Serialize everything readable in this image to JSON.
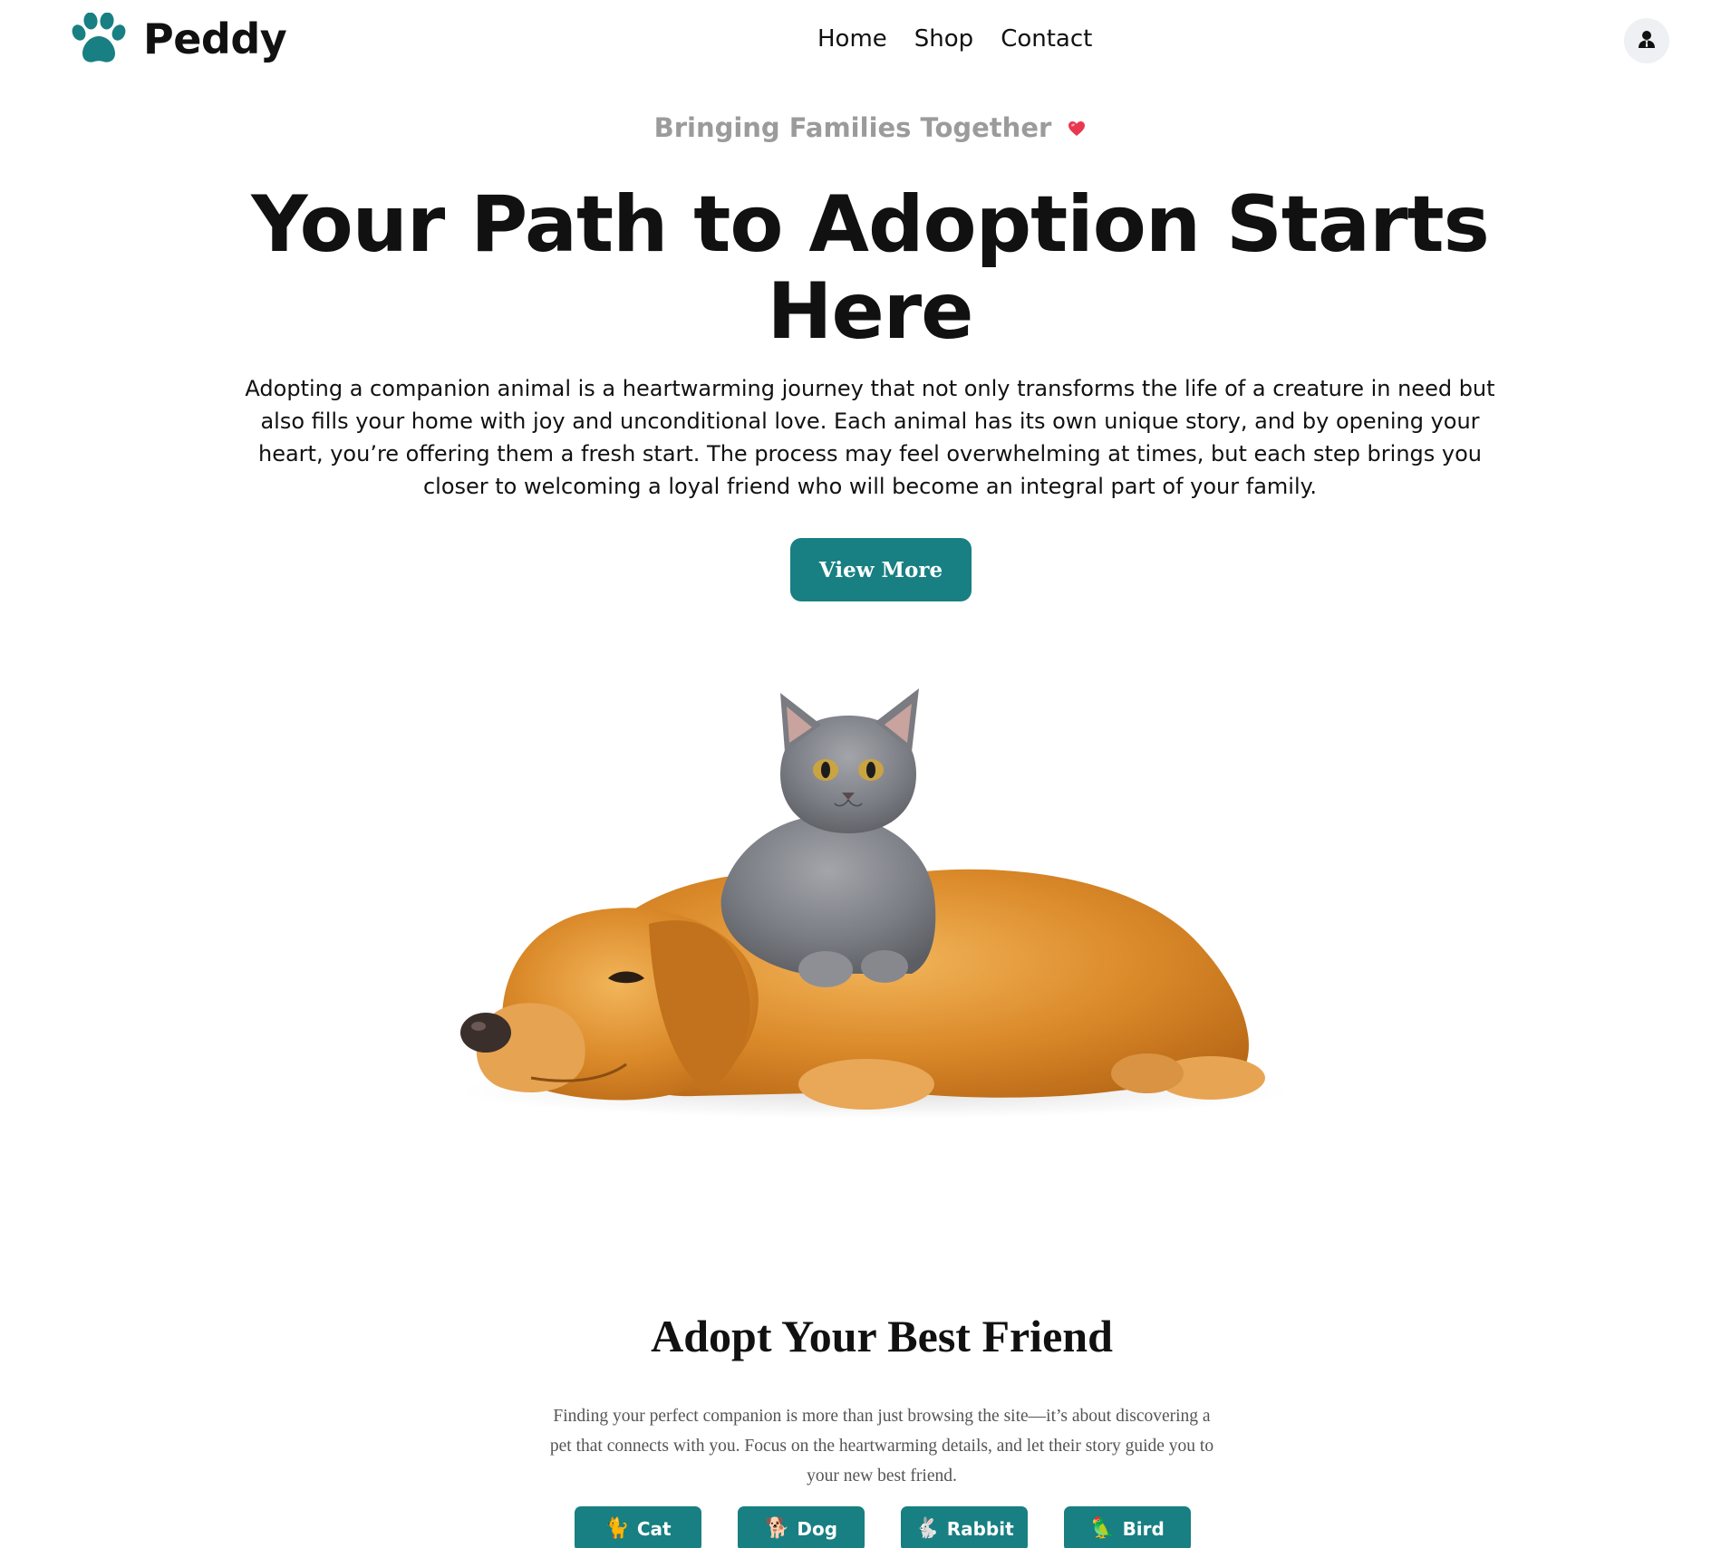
{
  "brand": {
    "name": "Peddy",
    "logo_icon": "paw-icon",
    "accent_color": "#187f82"
  },
  "nav": {
    "items": [
      {
        "label": "Home"
      },
      {
        "label": "Shop"
      },
      {
        "label": "Contact"
      }
    ],
    "account_icon": "user-icon"
  },
  "hero": {
    "tagline": "Bringing Families Together",
    "tagline_icon": "heart-icon",
    "title_line1": "Your Path to Adoption Starts",
    "title_line2": "Here",
    "description": "Adopting a companion animal is a heartwarming journey that not only transforms the life of a creature in need but also fills your home with joy and unconditional love. Each animal has its own unique story, and by opening your heart, you’re offering them a fresh start. The process may feel overwhelming at times, but each step brings you closer to welcoming a loyal friend who will become an integral part of your family.",
    "cta_label": "View More",
    "image": "golden-retriever-with-gray-kitten"
  },
  "adopt": {
    "title": "Adopt Your Best Friend",
    "description": "Finding your perfect companion is more than just browsing the site—it’s about discovering a pet that connects with you. Focus on the heartwarming details, and let their story guide you to your new best friend.",
    "categories": [
      {
        "label": "Cat",
        "emoji": "🐈",
        "icon": "cat-icon"
      },
      {
        "label": "Dog",
        "emoji": "🐕",
        "icon": "dog-icon"
      },
      {
        "label": "Rabbit",
        "emoji": "🐇",
        "icon": "rabbit-icon"
      },
      {
        "label": "Bird",
        "emoji": "🦜",
        "icon": "bird-icon"
      }
    ]
  }
}
